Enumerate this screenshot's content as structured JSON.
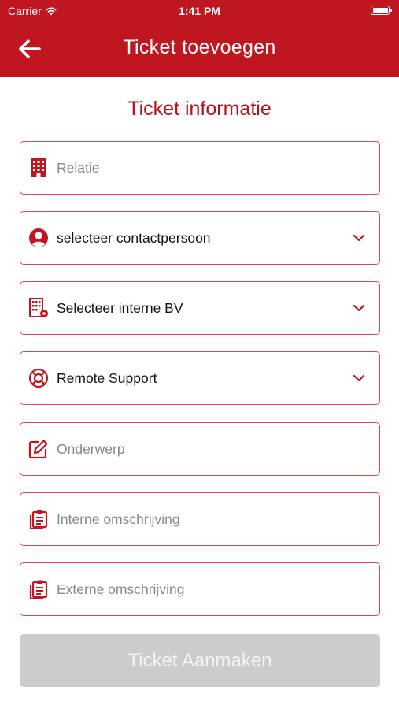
{
  "status_bar": {
    "carrier": "Carrier",
    "time": "1:41 PM"
  },
  "header": {
    "title": "Ticket toevoegen",
    "back_icon": "arrow-left-icon"
  },
  "section_title": "Ticket informatie",
  "fields": {
    "relatie": {
      "text": "Relatie",
      "icon": "building-icon",
      "kind": "placeholder"
    },
    "contactpersoon": {
      "text": "selecteer contactpersoon",
      "icon": "user-circle-icon",
      "kind": "dropdown"
    },
    "interne_bv": {
      "text": "Selecteer interne BV",
      "icon": "building-gear-icon",
      "kind": "dropdown"
    },
    "support_type": {
      "text": "Remote Support",
      "icon": "lifebuoy-icon",
      "kind": "dropdown"
    },
    "onderwerp": {
      "text": "Onderwerp",
      "icon": "edit-icon",
      "kind": "placeholder"
    },
    "interne_omschrijving": {
      "text": "Interne omschrijving",
      "icon": "clipboard-list-icon",
      "kind": "placeholder"
    },
    "externe_omschrijving": {
      "text": "Externe omschrijving",
      "icon": "clipboard-list-icon",
      "kind": "placeholder"
    }
  },
  "submit_label": "Ticket Aanmaken",
  "colors": {
    "brand_red": "#c0161f",
    "border_red": "#d94a4f",
    "disabled_gray": "#cccccc"
  }
}
